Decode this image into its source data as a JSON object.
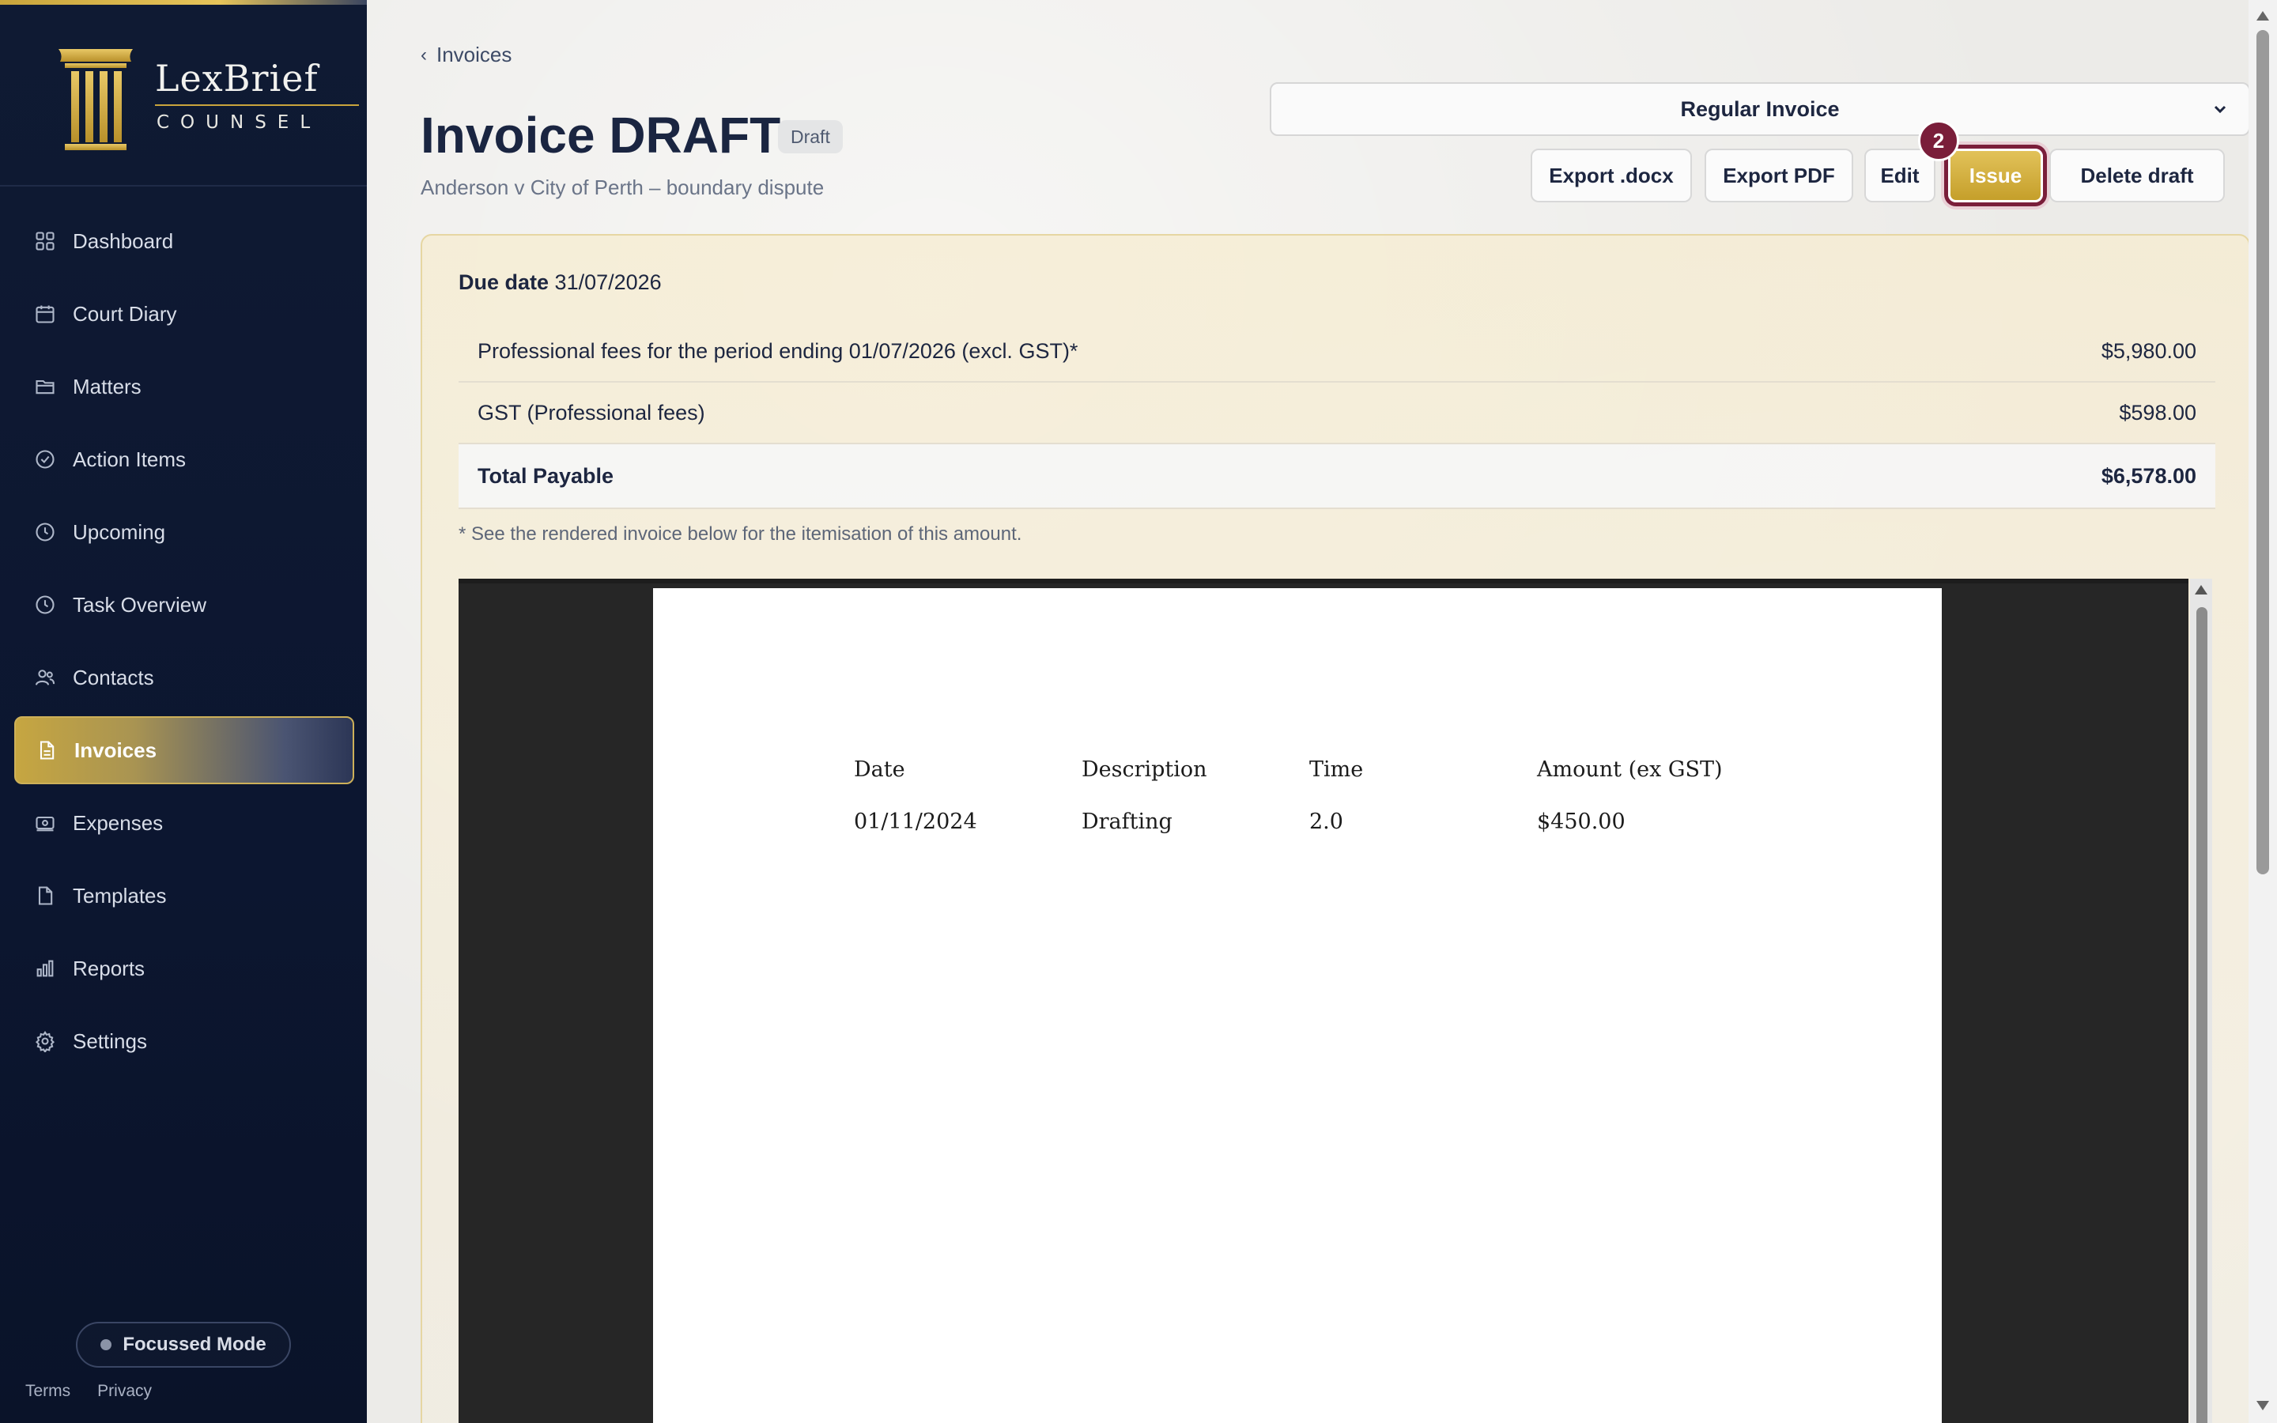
{
  "brand": {
    "name": "LexBrief",
    "sub": "COUNSEL"
  },
  "colors": {
    "sidebar_bg": "#0f1a33",
    "accent_gold": "#c9a53c",
    "highlight_maroon": "#7a1e3a"
  },
  "sidebar": {
    "items": [
      {
        "label": "Dashboard",
        "icon": "grid-icon",
        "active": false
      },
      {
        "label": "Court Diary",
        "icon": "calendar-icon",
        "active": false
      },
      {
        "label": "Matters",
        "icon": "folder-icon",
        "active": false
      },
      {
        "label": "Action Items",
        "icon": "check-circle-icon",
        "active": false
      },
      {
        "label": "Upcoming",
        "icon": "clock-icon",
        "active": false
      },
      {
        "label": "Task Overview",
        "icon": "clock-icon",
        "active": false
      },
      {
        "label": "Contacts",
        "icon": "users-icon",
        "active": false
      },
      {
        "label": "Invoices",
        "icon": "document-icon",
        "active": true
      },
      {
        "label": "Expenses",
        "icon": "cash-icon",
        "active": false
      },
      {
        "label": "Templates",
        "icon": "file-icon",
        "active": false
      },
      {
        "label": "Reports",
        "icon": "bar-chart-icon",
        "active": false
      },
      {
        "label": "Settings",
        "icon": "gear-icon",
        "active": false
      }
    ],
    "focus_label": "Focussed Mode",
    "footer": {
      "terms": "Terms",
      "privacy": "Privacy"
    }
  },
  "header": {
    "breadcrumb": "Invoices",
    "title": "Invoice DRAFT",
    "status": "Draft",
    "subtitle": "Anderson v City of Perth – boundary dispute",
    "invoice_type": "Regular Invoice"
  },
  "actions": {
    "export_docx": "Export .docx",
    "export_pdf": "Export PDF",
    "edit": "Edit",
    "issue": "Issue",
    "delete": "Delete draft",
    "step_badge": "2"
  },
  "summary": {
    "due_label": "Due date",
    "due_value": "31/07/2026",
    "lines": [
      {
        "label": "Professional fees for the period ending 01/07/2026 (excl. GST)*",
        "amount": "$5,980.00"
      },
      {
        "label": "GST (Professional fees)",
        "amount": "$598.00"
      }
    ],
    "total": {
      "label": "Total Payable",
      "amount": "$6,578.00"
    },
    "footnote": "* See the rendered invoice below for the itemisation of this amount."
  },
  "preview": {
    "columns": [
      "Date",
      "Description",
      "Time",
      "Amount (ex GST)"
    ],
    "rows": [
      {
        "date": "01/11/2024",
        "description": "Drafting",
        "time": "2.0",
        "amount": "$450.00"
      }
    ]
  }
}
